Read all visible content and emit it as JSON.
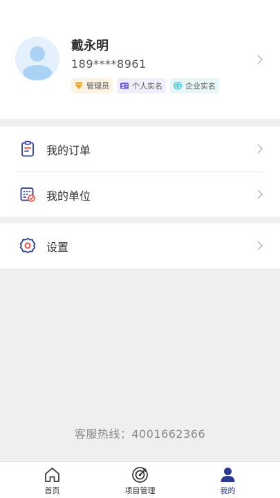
{
  "profile": {
    "name": "戴永明",
    "phone": "189****8961",
    "badges": [
      {
        "label": "管理员",
        "icon": "diamond-icon",
        "color": "#f5a623"
      },
      {
        "label": "个人实名",
        "icon": "id-card-icon",
        "color": "#6c5ce7"
      },
      {
        "label": "企业实名",
        "icon": "globe-icon",
        "color": "#2ec4d6"
      }
    ]
  },
  "menu": {
    "orders_label": "我的订单",
    "unit_label": "我的单位",
    "settings_label": "设置"
  },
  "footer": {
    "hotline": "客服热线：4001662366"
  },
  "tabbar": {
    "items": [
      {
        "label": "首页",
        "icon": "home-icon"
      },
      {
        "label": "项目管理",
        "icon": "target-icon"
      },
      {
        "label": "我的",
        "icon": "user-icon",
        "active": true
      }
    ]
  },
  "colors": {
    "accent": "#2b3a8f",
    "menu_icon_red": "#e8493f",
    "avatar_bg": "#e4f1fd",
    "avatar_fg": "#a9d2f5"
  }
}
